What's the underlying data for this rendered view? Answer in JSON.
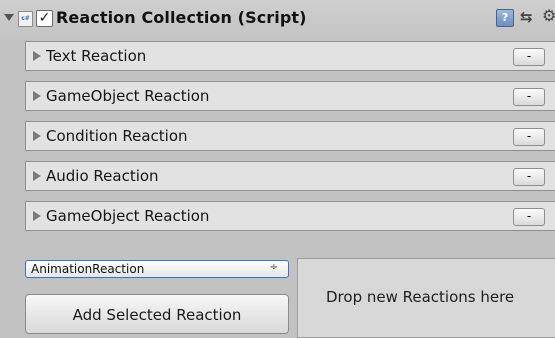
{
  "component": {
    "title": "Reaction Collection (Script)",
    "script_icon": "c#",
    "enabled_mark": "✓",
    "icons": {
      "fold": "triangle-down-icon",
      "script": "csharp-script-icon",
      "help": "help-book-icon",
      "preset": "preset-settings-icon",
      "gear": "gear-icon"
    }
  },
  "reactions": [
    {
      "label": "Text Reaction",
      "remove_label": "-"
    },
    {
      "label": "GameObject Reaction",
      "remove_label": "-"
    },
    {
      "label": "Condition Reaction",
      "remove_label": "-"
    },
    {
      "label": "Audio Reaction",
      "remove_label": "-"
    },
    {
      "label": "GameObject Reaction",
      "remove_label": "-"
    }
  ],
  "reaction_type_dropdown": {
    "selected": "AnimationReaction",
    "arrow": "÷"
  },
  "add_button_label": "Add Selected Reaction",
  "drop_zone_text": "Drop new Reactions here",
  "colors": {
    "panel_background": "#c2c2c2",
    "row_background": "#e2e2e2",
    "focus_outline": "#3d70c7"
  }
}
